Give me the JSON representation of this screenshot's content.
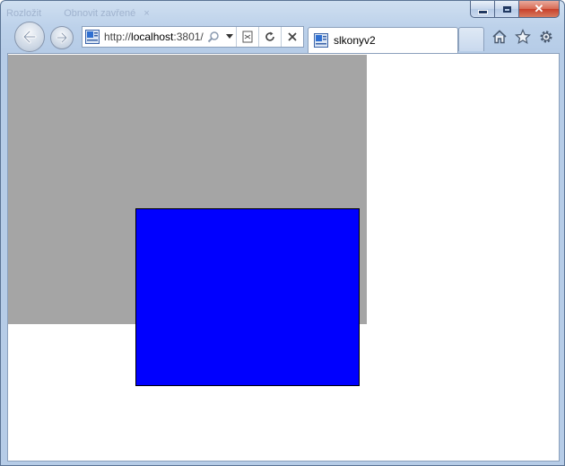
{
  "window": {
    "faded_tabs": [
      "Rozložit",
      "Obnovit zavřené"
    ],
    "faded_close": "×",
    "controls": {
      "close_glyph": "✕"
    }
  },
  "address_bar": {
    "url_prefix": "http://",
    "url_host": "localhost",
    "url_rest": ":3801/"
  },
  "tab": {
    "title": "slkonyv2"
  },
  "content": {
    "gray_box_color": "#a5a5a5",
    "blue_box_color": "#0000ff"
  },
  "icons": {
    "back": "back-arrow-icon",
    "forward": "forward-arrow-icon",
    "search": "search-icon",
    "dropdown": "chevron-down-icon",
    "compatibility": "compatibility-view-icon",
    "refresh": "refresh-icon",
    "stop": "stop-icon",
    "home": "home-icon",
    "favorites": "star-icon",
    "tools": "gear-icon"
  }
}
